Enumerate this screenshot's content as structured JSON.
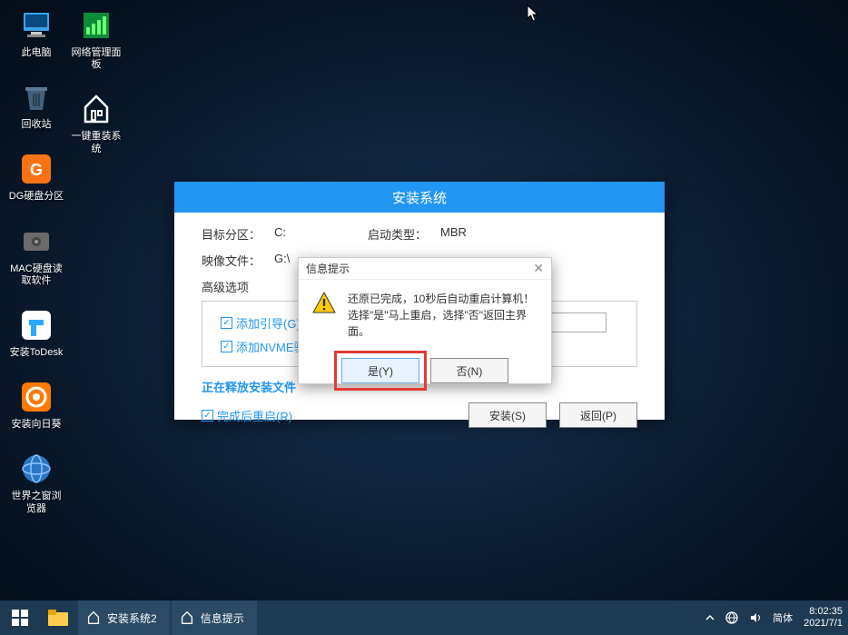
{
  "desktop": {
    "col1": [
      {
        "name": "this-pc",
        "label": "此电脑"
      },
      {
        "name": "recycle-bin",
        "label": "回收站"
      },
      {
        "name": "dg-disk",
        "label": "DG硬盘分区"
      },
      {
        "name": "mac-disk",
        "label": "MAC硬盘读取软件"
      },
      {
        "name": "todesk",
        "label": "安装ToDesk"
      },
      {
        "name": "sunflower",
        "label": "安装向日葵"
      },
      {
        "name": "browser",
        "label": "世界之窗浏览器"
      }
    ],
    "col2": [
      {
        "name": "net-panel",
        "label": "网络管理面板"
      },
      {
        "name": "onekey",
        "label": "一键重装系统"
      }
    ]
  },
  "installer": {
    "title": "安装系统",
    "target_label": "目标分区：",
    "target_value": "C:",
    "boot_label": "启动类型：",
    "boot_value": "MBR",
    "image_label": "映像文件：",
    "image_value": "G:\\",
    "advanced_label": "高级选项",
    "chk_boot": "添加引导(G):",
    "chk_nvme": "添加NVME驱",
    "progress_text": "正在释放安装文件",
    "chk_restart": "完成后重启(R)",
    "btn_install": "安装(S)",
    "btn_back": "返回(P)"
  },
  "dialog": {
    "title": "信息提示",
    "line1": "还原已完成，10秒后自动重启计算机！",
    "line2": "选择\"是\"马上重启，选择\"否\"返回主界面。",
    "btn_yes": "是(Y)",
    "btn_no": "否(N)"
  },
  "taskbar": {
    "task1": "安装系统2",
    "task2": "信息提示",
    "ime": "简体",
    "time": "8:02:35",
    "date": "2021/7/1"
  }
}
